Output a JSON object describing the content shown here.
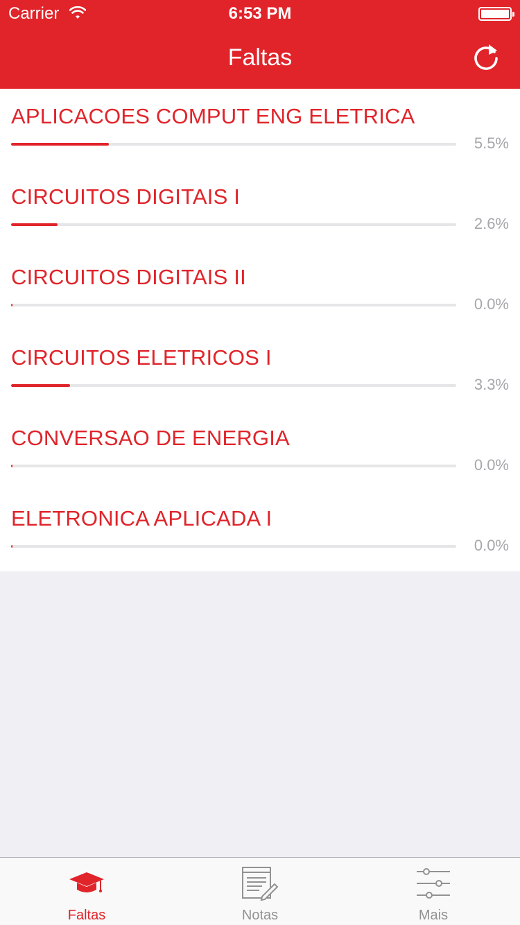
{
  "status_bar": {
    "carrier": "Carrier",
    "time": "6:53 PM"
  },
  "nav": {
    "title": "Faltas",
    "refresh_icon": "refresh-icon"
  },
  "colors": {
    "accent": "#e0242a",
    "track": "#e6e6e8",
    "percent_text": "#a6a6ab",
    "background": "#efeff4"
  },
  "courses": [
    {
      "name": "APLICACOES COMPUT ENG ELETRICA",
      "percent_label": "5.5%",
      "progress": 0.22
    },
    {
      "name": "CIRCUITOS DIGITAIS I",
      "percent_label": "2.6%",
      "progress": 0.105
    },
    {
      "name": "CIRCUITOS DIGITAIS II",
      "percent_label": "0.0%",
      "progress": 0.0
    },
    {
      "name": "CIRCUITOS ELETRICOS I",
      "percent_label": "3.3%",
      "progress": 0.133
    },
    {
      "name": "CONVERSAO DE ENERGIA",
      "percent_label": "0.0%",
      "progress": 0.0
    },
    {
      "name": "ELETRONICA APLICADA I",
      "percent_label": "0.0%",
      "progress": 0.0
    }
  ],
  "tabbar": {
    "tabs": [
      {
        "label": "Faltas",
        "icon": "graduation-cap-icon",
        "active": true
      },
      {
        "label": "Notas",
        "icon": "notes-icon",
        "active": false
      },
      {
        "label": "Mais",
        "icon": "sliders-icon",
        "active": false
      }
    ]
  }
}
